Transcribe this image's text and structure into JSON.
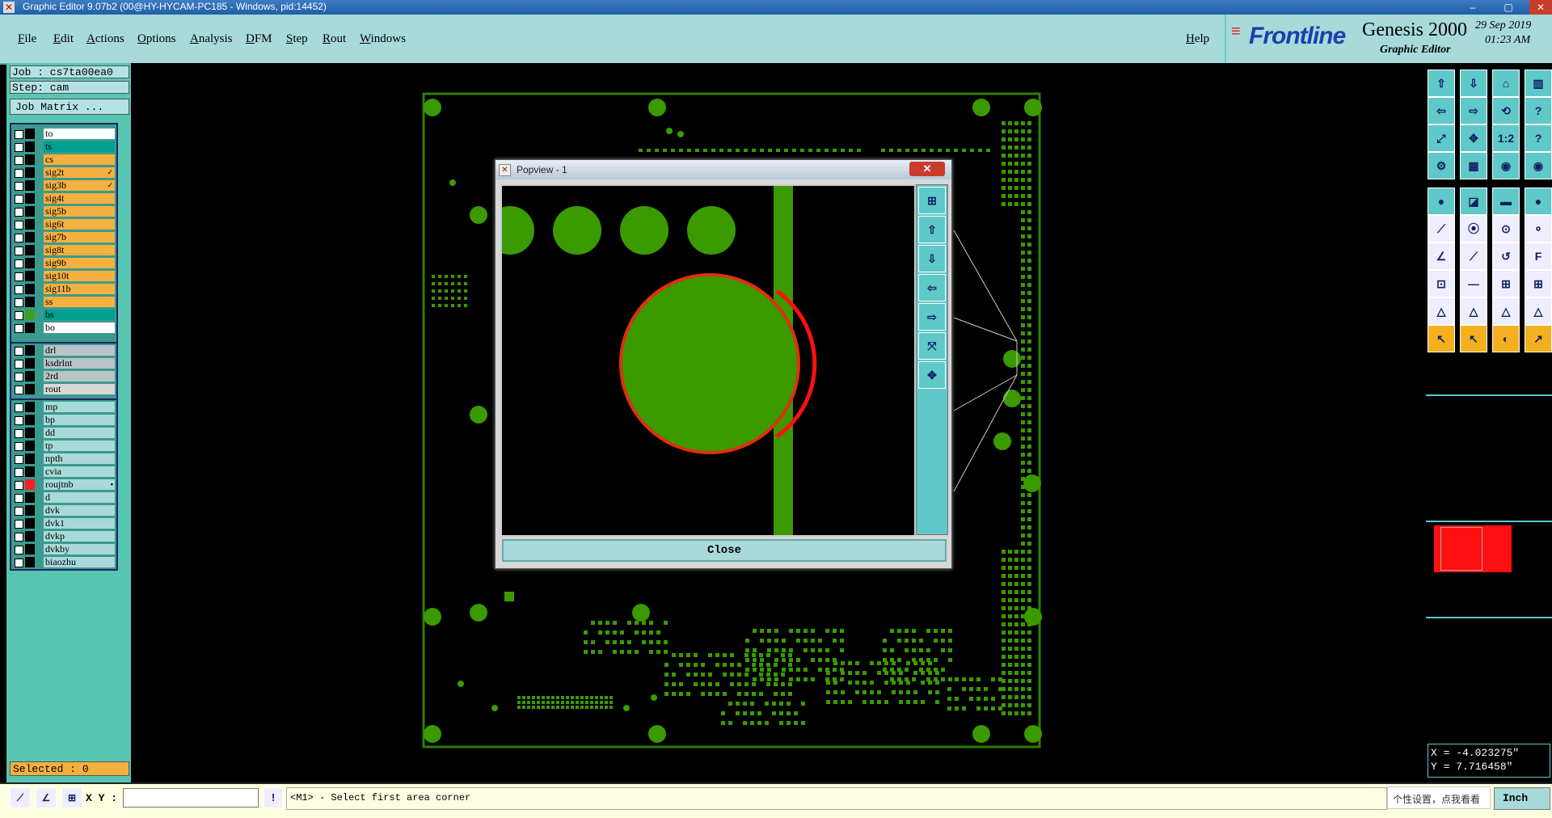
{
  "window": {
    "title": "Graphic Editor 9.07b2 (00@HY-HYCAM-PC185 - Windows, pid:14452)"
  },
  "menu": {
    "items": [
      "File",
      "Edit",
      "Actions",
      "Options",
      "Analysis",
      "DFM",
      "Step",
      "Rout",
      "Windows"
    ],
    "help": "Help"
  },
  "brand": {
    "company": "Frontline",
    "product": "Genesis 2000",
    "subtitle": "Graphic Editor",
    "date": "29 Sep 2019",
    "time": "01:23 AM"
  },
  "job": {
    "job_label": "Job : cs7ta00ea0",
    "step_label": "Step: cam",
    "matrix_button": "Job Matrix ..."
  },
  "layers": {
    "group1": [
      {
        "name": "to",
        "bg": "#ffffff",
        "swatch": "#000000"
      },
      {
        "name": "ts",
        "bg": "#00a090",
        "swatch": "#000000"
      },
      {
        "name": "cs",
        "bg": "#f5b040",
        "swatch": "#000000"
      },
      {
        "name": "sig2t",
        "bg": "#f5b040",
        "swatch": "#000000",
        "mark": "✓"
      },
      {
        "name": "sig3b",
        "bg": "#f5b040",
        "swatch": "#000000",
        "mark": "✓"
      },
      {
        "name": "sig4t",
        "bg": "#f5b040",
        "swatch": "#000000"
      },
      {
        "name": "sig5b",
        "bg": "#f5b040",
        "swatch": "#000000"
      },
      {
        "name": "sig6t",
        "bg": "#f5b040",
        "swatch": "#000000"
      },
      {
        "name": "sig7b",
        "bg": "#f5b040",
        "swatch": "#000000"
      },
      {
        "name": "sig8t",
        "bg": "#f5b040",
        "swatch": "#000000"
      },
      {
        "name": "sig9b",
        "bg": "#f5b040",
        "swatch": "#000000"
      },
      {
        "name": "sig10t",
        "bg": "#f5b040",
        "swatch": "#000000"
      },
      {
        "name": "sig11b",
        "bg": "#f5b040",
        "swatch": "#000000"
      },
      {
        "name": "ss",
        "bg": "#f5b040",
        "swatch": "#000000"
      },
      {
        "name": "bs",
        "bg": "#00a090",
        "swatch": "#3aa020"
      },
      {
        "name": "bo",
        "bg": "#ffffff",
        "swatch": "#000000"
      }
    ],
    "group2": [
      {
        "name": "drl",
        "bg": "#b8c4c8",
        "swatch": "#000000"
      },
      {
        "name": "ksdrlnt",
        "bg": "#b8c4c8",
        "swatch": "#000000"
      },
      {
        "name": "2rd",
        "bg": "#b8c4c8",
        "swatch": "#000000"
      },
      {
        "name": "rout",
        "bg": "#d8d8d8",
        "swatch": "#000000"
      }
    ],
    "group3": [
      {
        "name": "mp",
        "bg": "#a8dada",
        "swatch": "#000000"
      },
      {
        "name": "bp",
        "bg": "#a8dada",
        "swatch": "#000000"
      },
      {
        "name": "dd",
        "bg": "#a8dada",
        "swatch": "#000000"
      },
      {
        "name": "tp",
        "bg": "#a8dada",
        "swatch": "#000000"
      },
      {
        "name": "npth",
        "bg": "#a8dada",
        "swatch": "#000000"
      },
      {
        "name": "cvia",
        "bg": "#a8dada",
        "swatch": "#000000"
      },
      {
        "name": "roujtnb",
        "bg": "#a8dada",
        "swatch": "#ff2020",
        "mark": "▪"
      },
      {
        "name": "d",
        "bg": "#a8dada",
        "swatch": "#000000"
      },
      {
        "name": "dvk",
        "bg": "#a8dada",
        "swatch": "#000000"
      },
      {
        "name": "dvk1",
        "bg": "#a8dada",
        "swatch": "#000000"
      },
      {
        "name": "dvkp",
        "bg": "#a8dada",
        "swatch": "#000000"
      },
      {
        "name": "dvkby",
        "bg": "#a8dada",
        "swatch": "#000000"
      },
      {
        "name": "biaozhu",
        "bg": "#a8dada",
        "swatch": "#000000"
      }
    ]
  },
  "selected": "Selected : 0",
  "popview": {
    "title": "Popview - 1",
    "close_label": "Close"
  },
  "coords": {
    "x": "X = -4.023275\"",
    "y": "Y = 7.716458\""
  },
  "status": {
    "xy_label": "X Y :",
    "input_value": "",
    "message": "<M1> - Select first area corner",
    "units": "Inch",
    "ime_tip": "个性设置，点我看看"
  },
  "colors": {
    "board": "#3b9a00",
    "outline": "#2f7f00",
    "panel": "#56c6b1",
    "menubar": "#a8dada",
    "highlight": "#ff2010"
  }
}
